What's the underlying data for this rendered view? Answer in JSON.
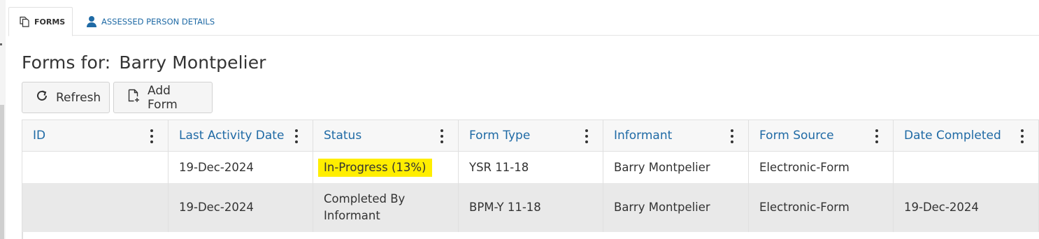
{
  "tabs": [
    {
      "label": "FORMS",
      "icon": "forms-copy-icon",
      "active": true
    },
    {
      "label": "ASSESSED PERSON DETAILS",
      "icon": "person-icon",
      "active": false
    }
  ],
  "page": {
    "title_prefix": "Forms for:",
    "person_name": "Barry Montpelier"
  },
  "toolbar": {
    "refresh_label": "Refresh",
    "refresh_icon": "refresh-icon",
    "add_form_label": "Add Form",
    "add_form_icon": "add-document-icon"
  },
  "grid": {
    "columns": [
      "ID",
      "Last Activity Date",
      "Status",
      "Form Type",
      "Informant",
      "Form Source",
      "Date Completed"
    ],
    "rows": [
      {
        "id": "",
        "last_activity_date": "19-Dec-2024",
        "status": "In-Progress (13%)",
        "form_type": "YSR 11-18",
        "informant": "Barry Montpelier",
        "form_source": "Electronic-Form",
        "date_completed": ""
      },
      {
        "id": "",
        "last_activity_date": "19-Dec-2024",
        "status": "Completed By Informant",
        "form_type": "BPM-Y 11-18",
        "informant": "Barry Montpelier",
        "form_source": "Electronic-Form",
        "date_completed": "19-Dec-2024"
      }
    ]
  },
  "colors": {
    "link_blue": "#1f6aa5",
    "status_highlight": "#ffee00",
    "alt_row": "#e9e9e9"
  }
}
